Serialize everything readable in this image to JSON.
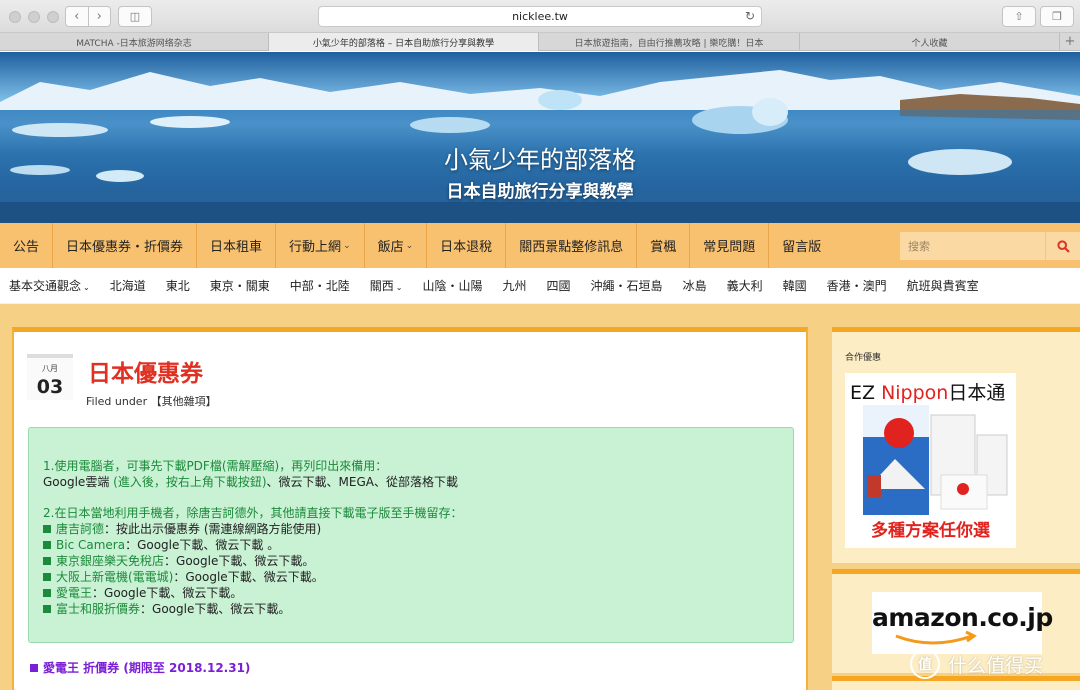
{
  "browser": {
    "url": "nicklee.tw",
    "tabs": [
      {
        "label": "MATCHA -日本旅游网络杂志"
      },
      {
        "label": "小氣少年的部落格 – 日本自助旅行分享與教學"
      },
      {
        "label": "日本旅遊指南，自由行推薦攻略 | 樂吃購！日本"
      },
      {
        "label": "个人收藏"
      }
    ]
  },
  "site": {
    "title": "小氣少年的部落格",
    "subtitle": "日本自助旅行分享與教學"
  },
  "main_nav": {
    "items": [
      {
        "label": "公告"
      },
      {
        "label": "日本優惠券・折價券"
      },
      {
        "label": "日本租車"
      },
      {
        "label": "行動上網"
      },
      {
        "label": "飯店"
      },
      {
        "label": "日本退稅"
      },
      {
        "label": "關西景點整修訊息"
      },
      {
        "label": "賞楓"
      },
      {
        "label": "常見問題"
      },
      {
        "label": "留言版"
      }
    ],
    "search_placeholder": "搜索"
  },
  "sub_nav": {
    "items": [
      {
        "label": "基本交通觀念"
      },
      {
        "label": "北海道"
      },
      {
        "label": "東北"
      },
      {
        "label": "東京・關東"
      },
      {
        "label": "中部・北陸"
      },
      {
        "label": "關西"
      },
      {
        "label": "山陰・山陽"
      },
      {
        "label": "九州"
      },
      {
        "label": "四國"
      },
      {
        "label": "沖繩・石垣島"
      },
      {
        "label": "冰島"
      },
      {
        "label": "義大利"
      },
      {
        "label": "韓國"
      },
      {
        "label": "香港・澳門"
      },
      {
        "label": "航班與貴賓室"
      }
    ]
  },
  "post": {
    "month": "八月",
    "day": "03",
    "title": "日本優惠券",
    "filed_under_label": "Filed under",
    "category": "【其他雜項】",
    "notice": {
      "p1_title": "1.使用電腦者，可事先下載PDF檔(需解壓縮)，再列印出來備用：",
      "p1_line_a": "Google雲端",
      "p1_line_b": " (進入後，按右上角下載按鈕)",
      "p1_line_c": "、微云下載、MEGA、從部落格下載",
      "p2_title": "2.在日本當地利用手機者，除唐吉訶德外，其他請直接下載電子版至手機留存：",
      "items": [
        {
          "name": "唐吉訶德",
          "text": "：按此出示優惠券 (需連線網路方能使用)"
        },
        {
          "name": "Bic Camera",
          "text": "：Google下載、微云下載 。"
        },
        {
          "name": "東京銀座樂天免稅店",
          "text": "：Google下載、微云下載。"
        },
        {
          "name": "大阪上新電機(電電城)",
          "text": "：Google下載、微云下載。"
        },
        {
          "name": "愛電王",
          "text": "：Google下載、微云下載。"
        },
        {
          "name": "富士和服折價券",
          "text": "：Google下載、微云下載。"
        }
      ]
    },
    "coupon_line": "愛電王 折價券 (期限至 2018.12.31)"
  },
  "sidebar": {
    "widget1_title": "合作優惠",
    "ez_brand_a": "EZ ",
    "ez_brand_b": "Nippon",
    "ez_brand_c": "日本通",
    "ez_tagline": "多種方案任你選",
    "amazon_label": "amazon.co.jp"
  },
  "watermark": {
    "icon_char": "值",
    "text": "什么值得买"
  },
  "colors": {
    "nav_bg": "#f8c16f",
    "title_red": "#e03021",
    "notice_bg": "#c9f1d4",
    "notice_green": "#1b8a3a",
    "coupon_purple": "#7a1fd6",
    "accent_orange": "#f5a623"
  }
}
